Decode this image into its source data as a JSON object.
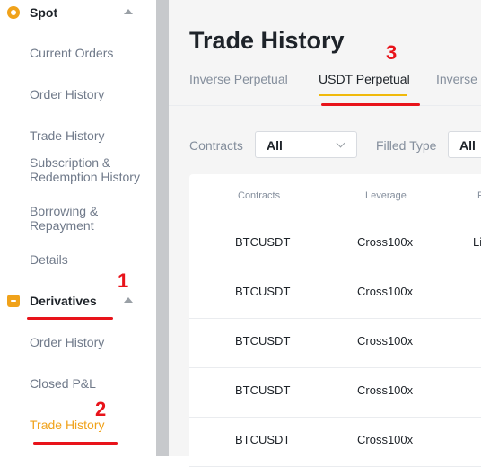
{
  "sidebar": {
    "spot": {
      "label": "Spot",
      "icon": "coin-icon"
    },
    "spot_items": [
      "Current Orders",
      "Order History",
      "Trade History",
      "Subscription & Redemption History",
      "Borrowing & Repayment",
      "Details"
    ],
    "derivatives": {
      "label": "Derivatives",
      "icon": "derivatives-icon"
    },
    "derivatives_items": [
      "Order History",
      "Closed P&L",
      "Trade History"
    ],
    "active_item": "Trade History"
  },
  "page": {
    "title": "Trade History",
    "tabs": [
      "Inverse Perpetual",
      "USDT Perpetual",
      "Inverse"
    ],
    "active_tab": "USDT Perpetual"
  },
  "filters": {
    "contracts_label": "Contracts",
    "contracts_value": "All",
    "filled_type_label": "Filled Type",
    "filled_type_value": "All"
  },
  "table": {
    "headers": [
      "Contracts",
      "Leverage",
      "F"
    ],
    "rows": [
      {
        "contract": "BTCUSDT",
        "leverage": "Cross100x",
        "extra": "Li"
      },
      {
        "contract": "BTCUSDT",
        "leverage": "Cross100x",
        "extra": ""
      },
      {
        "contract": "BTCUSDT",
        "leverage": "Cross100x",
        "extra": ""
      },
      {
        "contract": "BTCUSDT",
        "leverage": "Cross100x",
        "extra": ""
      },
      {
        "contract": "BTCUSDT",
        "leverage": "Cross100x",
        "extra": ""
      }
    ]
  },
  "annotations": [
    "1",
    "2",
    "3"
  ],
  "colors": {
    "accent": "#f0a21a",
    "annotation": "#e8131a",
    "tab_underline": "#f0b90b"
  }
}
